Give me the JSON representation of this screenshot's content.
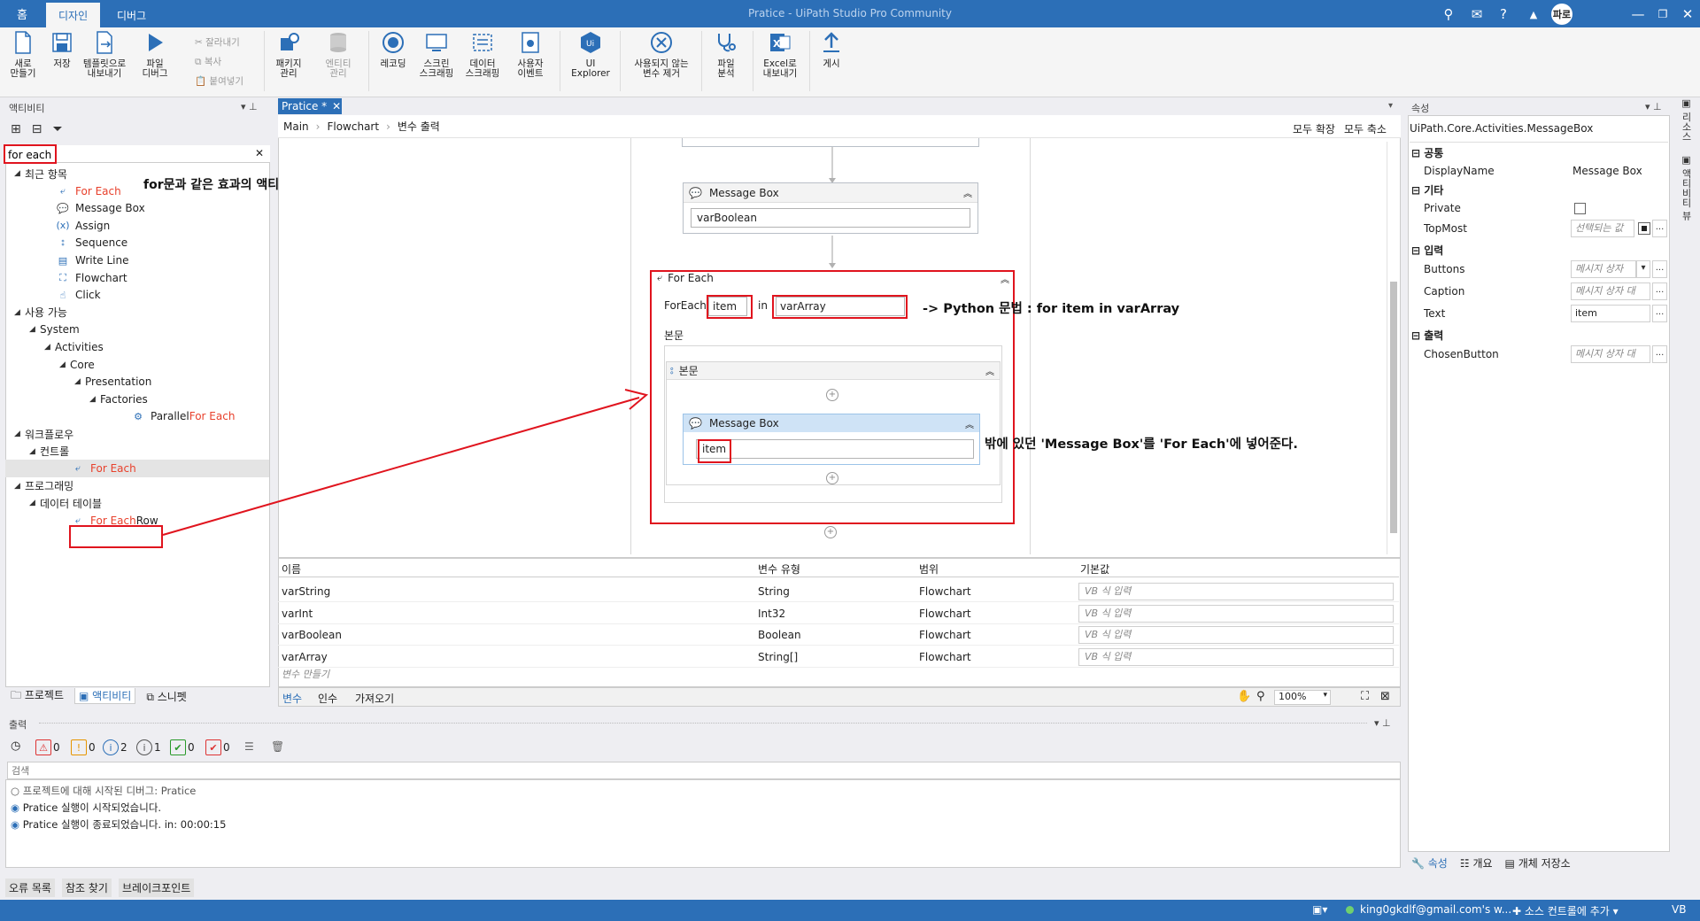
{
  "titlebar": {
    "home": "홈",
    "tabs": [
      "디자인",
      "디버그"
    ],
    "window_title": "Pratice - UiPath Studio Pro Community",
    "user_initial": "파로"
  },
  "ribbon": {
    "new_label": [
      "새로",
      "만들기"
    ],
    "save_label": "저장",
    "export_template_label": [
      "템플릿으로",
      "내보내기"
    ],
    "debug_file_label": [
      "파일",
      "디버그"
    ],
    "cut": "잘라내기",
    "copy": "복사",
    "paste": "붙여넣기",
    "manage_packages": [
      "패키지",
      "관리"
    ],
    "manage_entities": [
      "엔티티",
      "관리"
    ],
    "recording": "레코딩",
    "screen_scraping": [
      "스크린",
      "스크래핑"
    ],
    "data_scraping": [
      "데이터",
      "스크래핑"
    ],
    "user_events": [
      "사용자",
      "이벤트"
    ],
    "ui_explorer": [
      "UI",
      "Explorer"
    ],
    "remove_unused": [
      "사용되지 않는",
      "변수 제거"
    ],
    "analyze_file": [
      "파일",
      "분석"
    ],
    "export_excel": [
      "Excel로",
      "내보내기"
    ],
    "publish": "게시"
  },
  "activities_panel": {
    "title": "액티비티",
    "search_value": "for each",
    "annotation": "for문과 같은 효과의 액티비티.",
    "tree": [
      {
        "label": "최근 항목",
        "level": 0,
        "expand": true
      },
      {
        "label": "For Each",
        "level": 1,
        "red": true
      },
      {
        "label": "Message Box",
        "level": 1
      },
      {
        "label": "Assign",
        "level": 1
      },
      {
        "label": "Sequence",
        "level": 1
      },
      {
        "label": "Write Line",
        "level": 1
      },
      {
        "label": "Flowchart",
        "level": 1
      },
      {
        "label": "Click",
        "level": 1
      },
      {
        "label": "사용 가능",
        "level": 0,
        "expand": true
      },
      {
        "label": "System",
        "level": 1,
        "expand": true
      },
      {
        "label": "Activities",
        "level": 2,
        "expand": true
      },
      {
        "label": "Core",
        "level": 3,
        "expand": true
      },
      {
        "label": "Presentation",
        "level": 4,
        "expand": true
      },
      {
        "label": "Factories",
        "level": 5,
        "expand": true
      },
      {
        "label": "Parallel ",
        "label_red": "For Each",
        "level": 6
      },
      {
        "label": "워크플로우",
        "level": 0,
        "expand": true
      },
      {
        "label": "컨트롤",
        "level": 1,
        "expand": true
      },
      {
        "label": "For Each",
        "level": 2,
        "red": true,
        "selected": true
      },
      {
        "label": "프로그래밍",
        "level": 0,
        "expand": true
      },
      {
        "label": "데이터 테이블",
        "level": 1,
        "expand": true
      },
      {
        "label": "For Each",
        "label_rest": " Row",
        "level": 2,
        "red": true
      }
    ],
    "bottom_tabs": [
      "프로젝트",
      "액티비티",
      "스니펫"
    ]
  },
  "designer": {
    "tab": "Pratice *",
    "breadcrumb": [
      "Main",
      "Flowchart",
      "변수 출력"
    ],
    "expand_all": "모두 확장",
    "collapse_all": "모두 축소",
    "msgbox1": {
      "title": "Message Box",
      "text": "varBoolean"
    },
    "foreach": {
      "title": "For Each",
      "foreach_label": "ForEach",
      "item": "item",
      "in_label": "in",
      "collection": "varArray",
      "body_label": "본문",
      "body_seq": "본문"
    },
    "msgbox2": {
      "title": "Message Box",
      "text": "item"
    },
    "annotation_python": "-> Python 문법 : for item in varArray",
    "annotation_move": "밖에 있던 'Message Box'를 'For Each'에 넣어준다."
  },
  "variables": {
    "headers": [
      "이름",
      "변수 유형",
      "범위",
      "기본값"
    ],
    "rows": [
      {
        "name": "varString",
        "type": "String",
        "scope": "Flowchart",
        "default": "VB 식 입력"
      },
      {
        "name": "varInt",
        "type": "Int32",
        "scope": "Flowchart",
        "default": "VB 식 입력"
      },
      {
        "name": "varBoolean",
        "type": "Boolean",
        "scope": "Flowchart",
        "default": "VB 식 입력"
      },
      {
        "name": "varArray",
        "type": "String[]",
        "scope": "Flowchart",
        "default": "VB 식 입력"
      }
    ],
    "create": "변수 만들기",
    "tabs": [
      "변수",
      "인수",
      "가져오기"
    ],
    "zoom": "100%"
  },
  "properties": {
    "title": "속성",
    "type_name": "UiPath.Core.Activities.MessageBox",
    "sections": {
      "common": "공통",
      "misc": "기타",
      "input": "입력",
      "output": "출력"
    },
    "display_name_label": "DisplayName",
    "display_name": "Message Box",
    "private_label": "Private",
    "topmost_label": "TopMost",
    "topmost_value": "선택되는 값",
    "buttons_label": "Buttons",
    "buttons_value": "메시지 상자",
    "caption_label": "Caption",
    "caption_value": "메시지 상자 대",
    "text_label": "Text",
    "text_value": "item",
    "chosen_label": "ChosenButton",
    "chosen_value": "메시지 상자 대",
    "bottom_tabs": [
      "속성",
      "개요",
      "개체 저장소"
    ],
    "side_tabs": [
      "리소스",
      "액티비티 뷰"
    ]
  },
  "output": {
    "title": "출력",
    "counts": [
      "0",
      "0",
      "2",
      "1",
      "0",
      "0"
    ],
    "search_placeholder": "검색",
    "lines": [
      "프로젝트에 대해 시작된 디버그: Pratice",
      "Pratice 실행이 시작되었습니다.",
      "Pratice 실행이 종료되었습니다. in: 00:00:15"
    ]
  },
  "bottom_tabs": [
    "오류 목록",
    "참조 찾기",
    "브레이크포인트"
  ],
  "statusbar": {
    "account": "king0gkdlf@gmail.com's w...",
    "source_control": "소스 컨트롤에 추가",
    "lang": "VB"
  }
}
